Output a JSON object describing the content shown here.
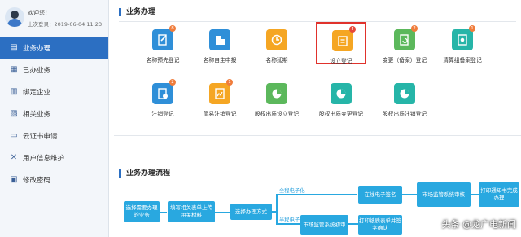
{
  "user": {
    "welcome": "欢迎您！",
    "last_login": "上次登录：2019-06-04 11:23"
  },
  "sidebar": {
    "items": [
      {
        "label": "业务办理",
        "icon": "document-stack-icon",
        "active": true
      },
      {
        "label": "已办业务",
        "icon": "document-icon",
        "active": false
      },
      {
        "label": "绑定企业",
        "icon": "building-icon",
        "active": false
      },
      {
        "label": "相关业务",
        "icon": "files-icon",
        "active": false
      },
      {
        "label": "云证书申请",
        "icon": "monitor-icon",
        "active": false
      },
      {
        "label": "用户信息维护",
        "icon": "tools-icon",
        "active": false
      },
      {
        "label": "修改密码",
        "icon": "lock-icon",
        "active": false
      }
    ]
  },
  "business": {
    "title": "业务办理",
    "tiles": [
      {
        "label": "名称预先登记",
        "badge": "8",
        "color": "#2f8fd8",
        "icon": "document-edit-icon"
      },
      {
        "label": "名称自主申报",
        "badge": "",
        "color": "#2f8fd8",
        "icon": "building-grid-icon"
      },
      {
        "label": "名称延期",
        "badge": "",
        "color": "#f5a623",
        "icon": "clock-icon"
      },
      {
        "label": "设立登记",
        "badge": "4",
        "color": "#f5a623",
        "icon": "clipboard-icon"
      },
      {
        "label": "变更（备案）登记",
        "badge": "2",
        "color": "#5cb85c",
        "icon": "refresh-document-icon"
      },
      {
        "label": "清算组备案登记",
        "badge": "1",
        "color": "#26b5a8",
        "icon": "certificate-icon"
      },
      {
        "label": "注销登记",
        "badge": "2",
        "color": "#2f8fd8",
        "icon": "cancel-document-icon"
      },
      {
        "label": "简易注销登记",
        "badge": "1",
        "color": "#f5a623",
        "icon": "chart-document-icon"
      },
      {
        "label": "股权出质设立登记",
        "badge": "",
        "color": "#5cb85c",
        "icon": "pie-chart-icon"
      },
      {
        "label": "股权出质变更登记",
        "badge": "",
        "color": "#26b5a8",
        "icon": "pie-refresh-icon"
      },
      {
        "label": "股权出质注销登记",
        "badge": "",
        "color": "#26b5a8",
        "icon": "pie-cancel-icon"
      }
    ]
  },
  "flow": {
    "title": "业务办理流程",
    "steps": {
      "select": "选择需要办理的业务",
      "fill": "填写相关表单上传相关材料",
      "method": "选择办理方式",
      "sign": "在线电子签名",
      "review": "市场监管系统审核",
      "notice": "打印通知书完成办理",
      "first_review": "市场监管系统初审",
      "print_sign": "打印纸质表单并签字确认"
    },
    "branch_full": "全程电子化",
    "branch_half": "半程电子化"
  },
  "watermark": "头条 @龙广电新闻"
}
